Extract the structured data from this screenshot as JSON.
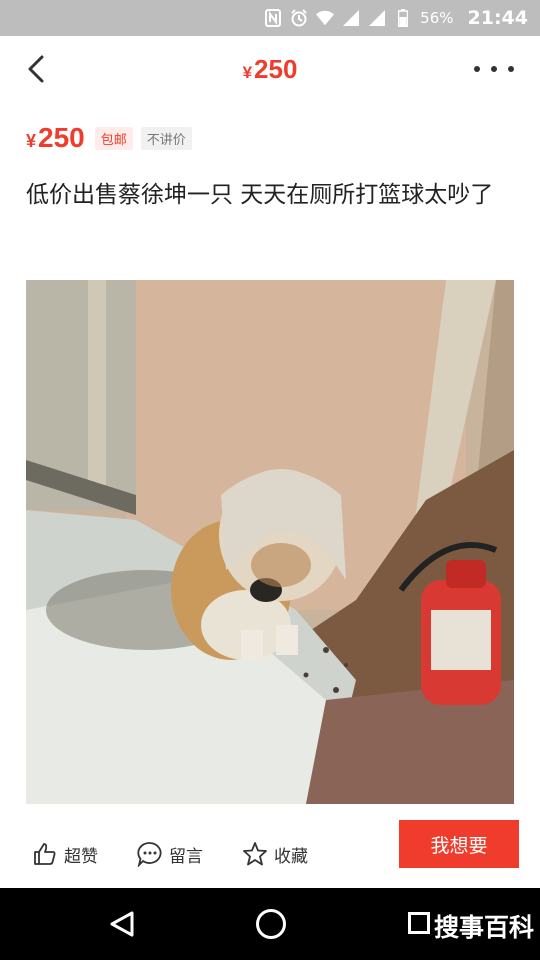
{
  "status_bar": {
    "battery": "56%",
    "time": "21:44",
    "icons": [
      "nfc-icon",
      "alarm-icon",
      "wifi-icon",
      "signal-icon",
      "signal-icon-2",
      "battery-icon"
    ]
  },
  "header": {
    "currency": "¥",
    "price": "250",
    "back_icon": "chevron-left-icon",
    "more_icon": "more-dots-icon"
  },
  "listing": {
    "currency": "¥",
    "price": "250",
    "tag_shipping": "包邮",
    "tag_fixed": "不讲价",
    "description": "低价出售蔡徐坤一只 天天在厕所打篮球太吵了"
  },
  "actions": {
    "like_label": "超赞",
    "comment_label": "留言",
    "favorite_label": "收藏",
    "want_label": "我想要"
  },
  "nav": {
    "watermark": "搜事百科"
  },
  "colors": {
    "accent": "#ef3c2c",
    "status_bar": "#bdbdbd",
    "nav_bar": "#000000"
  }
}
